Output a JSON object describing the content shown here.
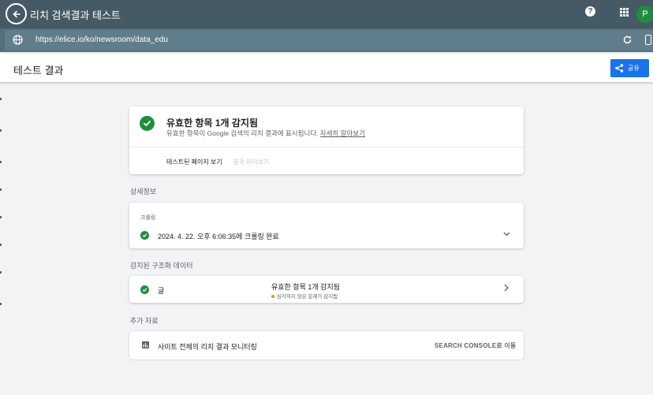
{
  "topbar": {
    "title": "리치 검색결과 테스트",
    "help_icon": "help-circle-icon",
    "apps_icon": "apps-grid-icon",
    "avatar_initial": "P",
    "colors": {
      "bar": "#455a64",
      "avatar": "#1e8e3e"
    }
  },
  "urlbar": {
    "url": "https://elice.io/ko/newsroom/data_edu",
    "globe_icon": "globe-icon",
    "refresh_icon": "refresh-icon",
    "device_icon": "smartphone-icon"
  },
  "header": {
    "title": "테스트 결과",
    "share_label": "공유",
    "colors": {
      "share_button": "#1a73e8"
    }
  },
  "summary": {
    "title": "유효한 항목 1개 감지됨",
    "subtitle": "유효한 항목이 Google 검색의 리치 결과에 표시됩니다.",
    "learn_more": "자세히 알아보기",
    "tab_tested_page": "테스트된 페이지 보기",
    "tab_preview": "결과 미리보기"
  },
  "details": {
    "section_label": "상세정보",
    "crawl_label": "크롤링",
    "crawl_status": "2024. 4. 22. 오후 6:06:35에 크롤링 완료"
  },
  "structured_data": {
    "section_label": "감지된 구조화 데이터",
    "item_label": "글",
    "item_title": "유효한 항목 1개 감지됨",
    "item_warning": "심각하지 않은 문제가 감지됨",
    "colors": {
      "check": "#1e8e3e",
      "warning": "#f29900"
    }
  },
  "resources": {
    "section_label": "추가 자료",
    "monitor_text": "사이트 전체의 리치 결과 모니터링",
    "monitor_link": "SEARCH CONSOLE로 이동"
  }
}
